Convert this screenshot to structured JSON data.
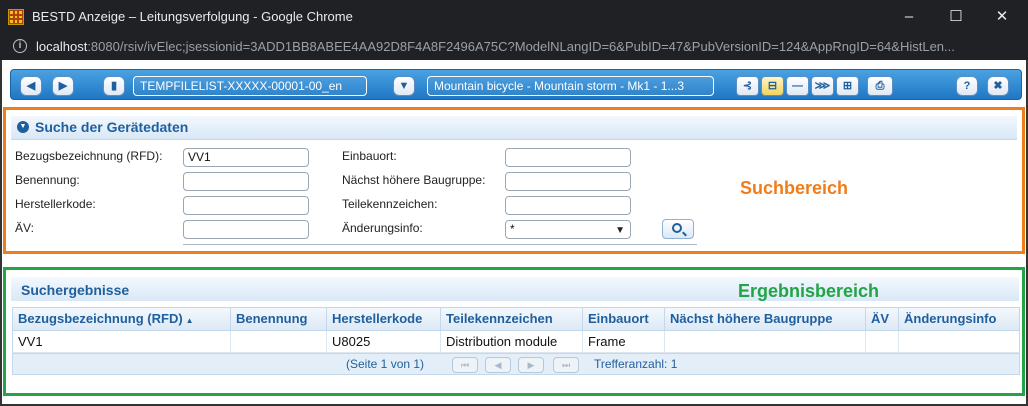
{
  "window": {
    "title": "BESTD Anzeige – Leitungsverfolgung - Google Chrome",
    "minimize": "–",
    "maximize": "☐",
    "close": "✕",
    "url_host": "localhost",
    "url_rest": ":8080/rsiv/ivElec;jsessionid=3ADD1BB8ABEE4AA92D8F4A8F2496A75C?ModelNLangID=6&PubID=47&PubVersionID=124&AppRngID=64&HistLen..."
  },
  "toolbar": {
    "back_icon": "◀",
    "forward_icon": "▶",
    "book_icon": "▮",
    "doc_field": "TEMPFILELIST-XXXXX-00001-00_en",
    "filter_icon": "▼",
    "model_field": "Mountain bicycle - Mountain storm - Mk1 - 1...3",
    "tool_icons": [
      "⊰",
      "⊟",
      "—",
      "⋙",
      "⊞",
      "⎙"
    ],
    "help_label": "?",
    "close_label": "✖"
  },
  "search": {
    "title": "Suche der Gerätedaten",
    "fields_left": [
      {
        "label": "Bezugsbezeichnung (RFD):",
        "value": "VV1"
      },
      {
        "label": "Benennung:",
        "value": ""
      },
      {
        "label": "Herstellerkode:",
        "value": ""
      },
      {
        "label": "ÄV:",
        "value": ""
      }
    ],
    "fields_right": [
      {
        "label": "Einbauort:",
        "value": ""
      },
      {
        "label": "Nächst höhere Baugruppe:",
        "value": ""
      },
      {
        "label": "Teilekennzeichen:",
        "value": ""
      },
      {
        "label": "Änderungsinfo:",
        "value": "*"
      }
    ],
    "area_label": "Suchbereich",
    "area_color": "#f07d1a"
  },
  "results": {
    "title": "Suchergebnisse",
    "area_label": "Ergebnisbereich",
    "area_color": "#22a447",
    "sort_indicator": "▲",
    "columns": [
      "Bezugsbezeichnung (RFD)",
      "Benennung",
      "Herstellerkode",
      "Teilekennzeichen",
      "Einbauort",
      "Nächst höhere Baugruppe",
      "ÄV",
      "Änderungsinfo"
    ],
    "rows": [
      [
        "VV1",
        "",
        "U8025",
        "Distribution module",
        "Frame",
        "",
        "",
        ""
      ]
    ],
    "pager": {
      "page_info": "(Seite 1 von 1)",
      "first": "⏮",
      "prev": "◀",
      "next": "▶",
      "last": "⏭",
      "hits": "Trefferanzahl: 1"
    }
  }
}
